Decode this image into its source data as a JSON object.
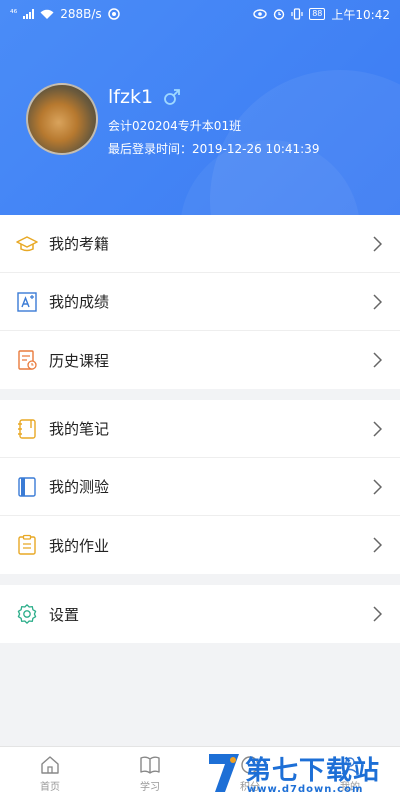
{
  "status_bar": {
    "signal": "⁴⁶",
    "speed": "288B/s",
    "battery": "88",
    "time": "上午10:42"
  },
  "profile": {
    "username": "lfzk1",
    "gender_icon": "male-icon",
    "class_name": "会计020204专升本01班",
    "last_login": "最后登录时间：2019-12-26 10:41:39"
  },
  "menu": {
    "group1": [
      {
        "label": "我的考籍",
        "icon": "graduation-cap-icon",
        "color": "#e8a825"
      },
      {
        "label": "我的成绩",
        "icon": "grade-icon",
        "color": "#3a7bd5"
      },
      {
        "label": "历史课程",
        "icon": "history-course-icon",
        "color": "#e97b3d"
      }
    ],
    "group2": [
      {
        "label": "我的笔记",
        "icon": "notebook-icon",
        "color": "#e8a825"
      },
      {
        "label": "我的测验",
        "icon": "quiz-book-icon",
        "color": "#3a7bd5"
      },
      {
        "label": "我的作业",
        "icon": "clipboard-icon",
        "color": "#e8a825"
      }
    ],
    "group3": [
      {
        "label": "设置",
        "icon": "gear-icon",
        "color": "#2cae8a"
      }
    ]
  },
  "bottom_nav": [
    {
      "label": "首页",
      "icon": "home-icon"
    },
    {
      "label": "学习",
      "icon": "book-icon"
    },
    {
      "label": "积分",
      "icon": "points-icon"
    },
    {
      "label": "我的",
      "icon": "profile-icon"
    }
  ],
  "watermark": {
    "text": "第七下载站",
    "url": "www.d7down.com"
  },
  "colors": {
    "header": "#4a8cf7",
    "accent_blue": "#3a7bd5",
    "accent_orange": "#e8a825",
    "accent_green": "#2cae8a"
  }
}
